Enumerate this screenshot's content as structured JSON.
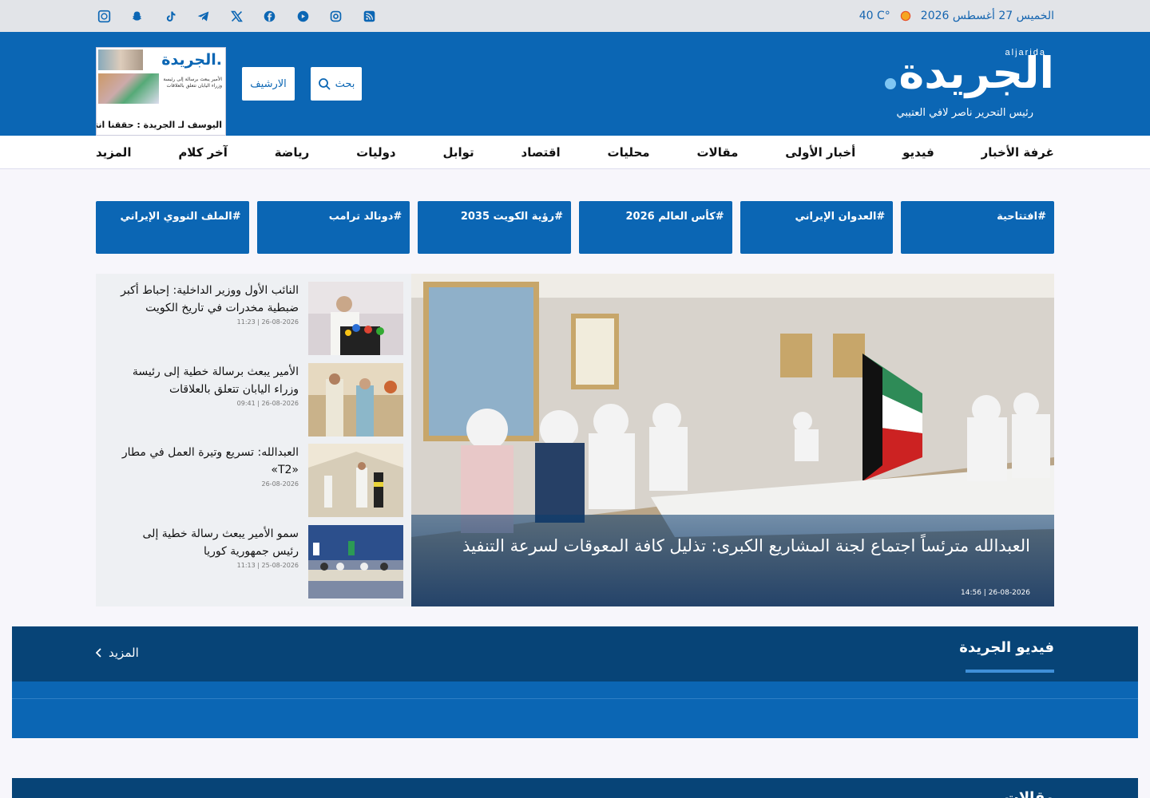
{
  "topbar": {
    "temperature": "40 C°",
    "date": "الخميس 27 أغسطس 2026",
    "social_icons": [
      "rss-icon",
      "instagram-icon",
      "youtube-icon",
      "facebook-icon",
      "x-icon",
      "telegram-icon",
      "tiktok-icon",
      "snapchat-icon",
      "whatsapp-icon"
    ]
  },
  "header": {
    "logo_arabic": "الجريدة",
    "logo_latin": "aljarida",
    "editor": "رئيس التحرير ناصر لافي العتيبي",
    "search_label": "بحث",
    "archive_label": "الارشيف",
    "paper": {
      "masthead": "الجريدة.",
      "headline": "اليوسف لـ الجريدة : حققنا انتصارات",
      "subtext": "الأمير يبعث برسالة إلى رئيسة وزراء اليابان تتعلق بالعلاقات"
    }
  },
  "nav": [
    "غرفة الأخبار",
    "فيديو",
    "أخبار الأولى",
    "مقالات",
    "محليات",
    "اقتصاد",
    "توابل",
    "دوليات",
    "رياضة",
    "آخر كلام",
    "المزيد"
  ],
  "tags": [
    "#افتتاحية",
    "#العدوان الإيراني",
    "#كأس العالم 2026",
    "#رؤية الكويت 2035",
    "#دونالد ترامب",
    "#الملف النووي الإيراني"
  ],
  "hero": {
    "title": "العبدالله مترئساً اجتماع لجنة المشاريع الكبرى: تذليل كافة المعوقات لسرعة التنفيذ",
    "date": "14:56 | 26-08-2026"
  },
  "stories": [
    {
      "title": "النائب الأول ووزير الداخلية: إحباط أكبر ضبطية مخدرات في تاريخ الكويت",
      "date": "11:23 | 26-08-2026"
    },
    {
      "title": "الأمير يبعث برسالة خطية إلى رئيسة وزراء اليابان تتعلق بالعلاقات",
      "date": "09:41 | 26-08-2026"
    },
    {
      "title": "العبدالله: تسريع وتيرة العمل في مطار «T2»",
      "date": "26-08-2026"
    },
    {
      "title": "سمو الأمير يبعث رسالة خطية إلى رئيس جمهورية كوريا",
      "date": "11:13 | 25-08-2026"
    }
  ],
  "video": {
    "title": "فيديو الجريدة",
    "more": "المزيد"
  },
  "articles": {
    "title": "مقالات"
  }
}
